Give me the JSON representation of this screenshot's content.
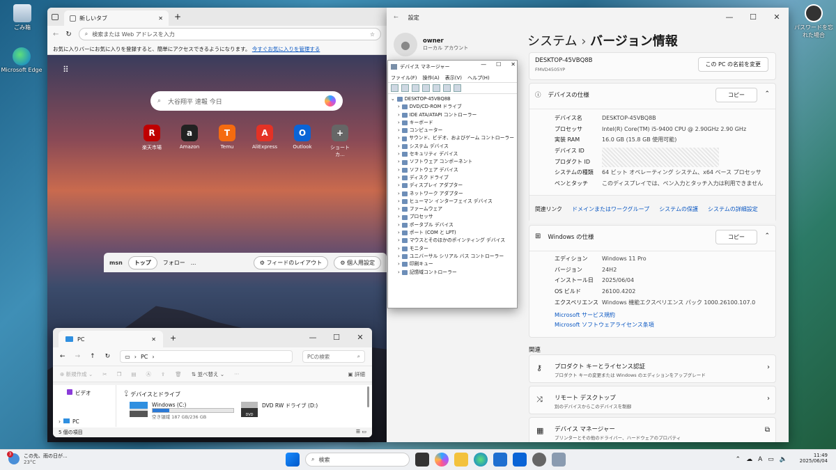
{
  "desktop": {
    "recycle": "ごみ箱",
    "edge": "Microsoft Edge",
    "user_label": "パスワードを忘れた場合"
  },
  "edge": {
    "tab": "新しいタブ",
    "search_placeholder": "検索または Web アドレスを入力",
    "fav_text": "お気に入りバーにお気に入りを登録すると、簡単にアクセスできるようになります。",
    "fav_link": "今すぐお気に入りを管理する",
    "ntp_query": "大谷翔平 速報 今日",
    "quick": [
      {
        "label": "楽天市場",
        "glyph": "R",
        "color": "#bf0000"
      },
      {
        "label": "Amazon",
        "glyph": "a",
        "color": "#222"
      },
      {
        "label": "Temu",
        "glyph": "T",
        "color": "#f56b10"
      },
      {
        "label": "AliExpress",
        "glyph": "A",
        "color": "#e43225"
      },
      {
        "label": "Outlook",
        "glyph": "O",
        "color": "#0a64d6"
      },
      {
        "label": "ショートカ...",
        "glyph": "+",
        "color": "#666"
      }
    ],
    "msn": {
      "logo": "msn",
      "top": "トップ",
      "follow": "フォロー",
      "more": "...",
      "layout": "フィードのレイアウト",
      "personal": "個人用設定"
    }
  },
  "explorer": {
    "tab": "PC",
    "add": "+",
    "path": "PC",
    "search": "PCの検索",
    "new": "新規作成",
    "sort": "並べ替え",
    "view": "表示",
    "details": "詳細",
    "side_video": "ビデオ",
    "side_pc": "PC",
    "group": "デバイスとドライブ",
    "drive_c": "Windows (C:)",
    "drive_c_free": "空き領域 187 GB/236 GB",
    "drive_c_used": 0.21,
    "drive_d": "DVD RW ドライブ (D:)",
    "dvd": "DVD",
    "status": "5 個の項目"
  },
  "settings": {
    "title": "設定",
    "user": "owner",
    "account": "ローカル アカウント",
    "breadcrumb_parent": "システム",
    "breadcrumb_sep": "›",
    "breadcrumb_current": "バージョン情報",
    "pc_name": "DESKTOP-45VBQ8B",
    "model": "FMVD4505YP",
    "rename": "この PC の名前を変更",
    "copy": "コピー",
    "device_spec": "デバイスの仕様",
    "spec": [
      {
        "k": "デバイス名",
        "v": "DESKTOP-45VBQ8B"
      },
      {
        "k": "プロセッサ",
        "v": "Intel(R) Core(TM) i5-9400 CPU @ 2.90GHz   2.90 GHz"
      },
      {
        "k": "実装 RAM",
        "v": "16.0 GB (15.8 GB 使用可能)"
      },
      {
        "k": "デバイス ID",
        "v": ""
      },
      {
        "k": "プロダクト ID",
        "v": ""
      },
      {
        "k": "システムの種類",
        "v": "64 ビット オペレーティング システム、x64 ベース プロセッサ"
      },
      {
        "k": "ペンとタッチ",
        "v": "このディスプレイでは、ペン入力とタッチ入力は利用できません"
      }
    ],
    "related_label": "関連リンク",
    "related": [
      "ドメインまたはワークグループ",
      "システムの保護",
      "システムの詳細設定"
    ],
    "win_spec": "Windows の仕様",
    "wspec": [
      {
        "k": "エディション",
        "v": "Windows 11 Pro"
      },
      {
        "k": "バージョン",
        "v": "24H2"
      },
      {
        "k": "インストール日",
        "v": "2025/06/04"
      },
      {
        "k": "OS ビルド",
        "v": "26100.4202"
      },
      {
        "k": "エクスペリエンス",
        "v": "Windows 機能エクスペリエンス パック 1000.26100.107.0"
      }
    ],
    "ms_links": [
      "Microsoft サービス規約",
      "Microsoft ソフトウェアライセンス条項"
    ],
    "related_head": "関連",
    "items": [
      {
        "title": "プロダクト キーとライセンス認証",
        "sub": "プロダクト キーの変更または Windows のエディションをアップグレード",
        "arrow": "›"
      },
      {
        "title": "リモート デスクトップ",
        "sub": "別のデバイスからこのデバイスを制御",
        "arrow": "›"
      },
      {
        "title": "デバイス マネージャー",
        "sub": "プリンターとその他のドライバー、ハードウェアのプロパティ",
        "arrow": "⧉"
      }
    ]
  },
  "devmgr": {
    "title": "デバイス マネージャー",
    "menu": [
      "ファイル(F)",
      "操作(A)",
      "表示(V)",
      "ヘルプ(H)"
    ],
    "root": "DESKTOP-45VBQ8B",
    "nodes": [
      "DVD/CD-ROM ドライブ",
      "IDE ATA/ATAPI コントローラー",
      "キーボード",
      "コンピューター",
      "サウンド、ビデオ、およびゲーム コントローラー",
      "システム デバイス",
      "セキュリティ デバイス",
      "ソフトウェア コンポーネント",
      "ソフトウェア デバイス",
      "ディスク ドライブ",
      "ディスプレイ アダプター",
      "ネットワーク アダプター",
      "ヒューマン インターフェイス デバイス",
      "ファームウェア",
      "プロセッサ",
      "ポータブル デバイス",
      "ポート (COM と LPT)",
      "マウスとそのほかのポインティング デバイス",
      "モニター",
      "ユニバーサル シリアル バス コントローラー",
      "印刷キュー",
      "記憶域コントローラー"
    ]
  },
  "taskbar": {
    "weather": "この先、雨の日が...",
    "temp": "23°C",
    "badge": "3",
    "search": "検索",
    "time": "11:49",
    "date": "2025/06/04"
  }
}
